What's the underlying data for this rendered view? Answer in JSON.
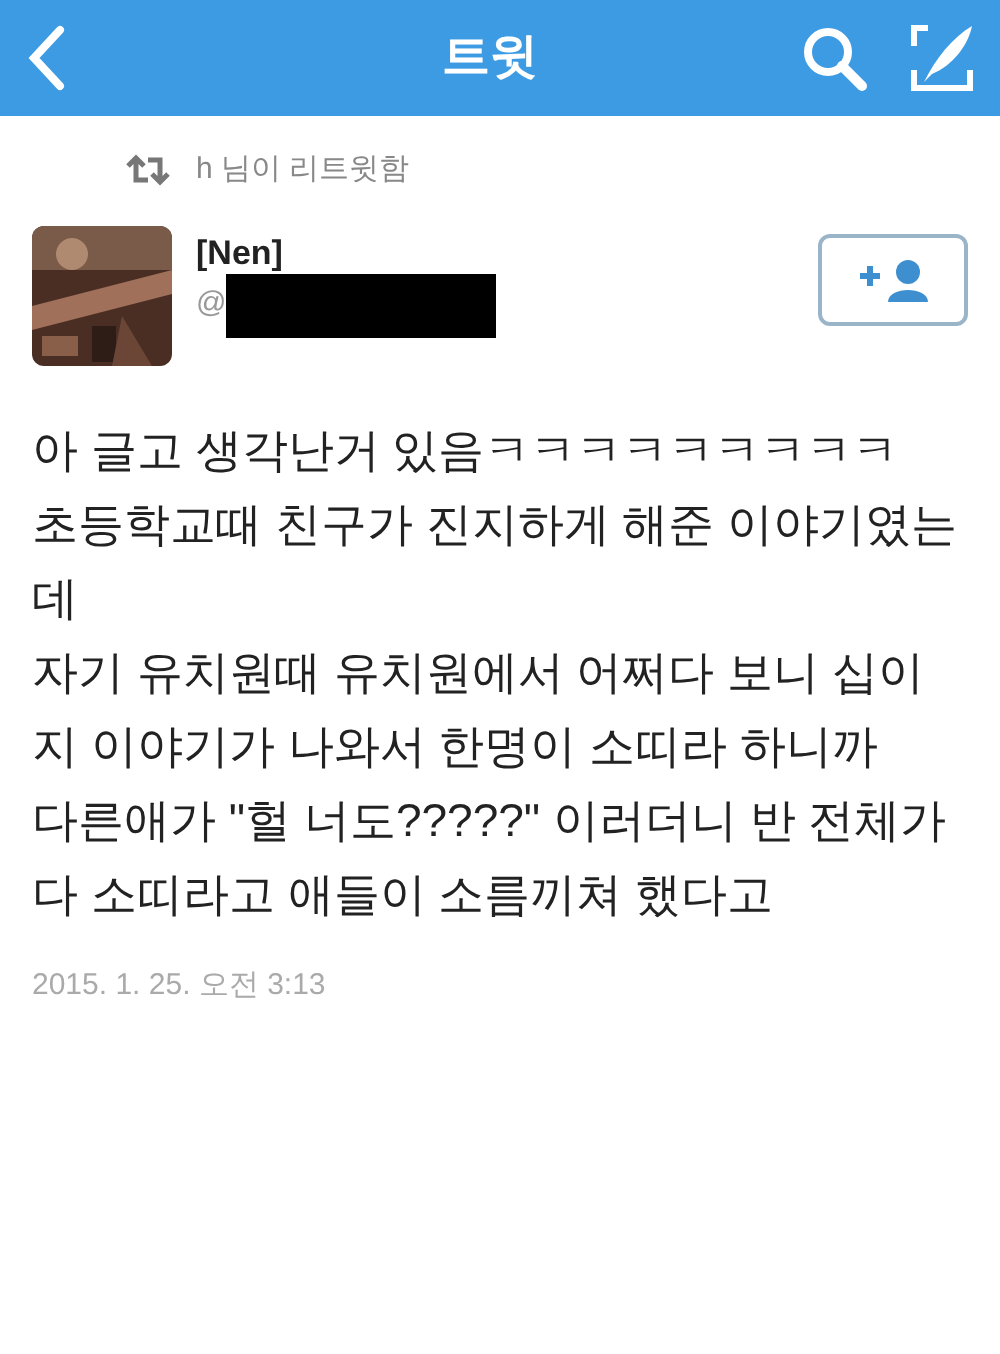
{
  "header": {
    "title": "트윗"
  },
  "retweet": {
    "text": "h 님이 리트윗함"
  },
  "author": {
    "name": "[Nen]",
    "handle": "@"
  },
  "tweet": {
    "lines": [
      "아 글고 생각난거 있음ㅋㅋㅋㅋㅋㅋㅋㅋㅋ",
      "초등학교때 친구가 진지하게 해준 이야기였는데",
      "자기 유치원때 유치원에서 어쩌다 보니 십이지 이야기가 나와서 한명이 소띠라 하니까",
      "다른애가 \"헐 너도?????\" 이러더니 반 전체가 다 소띠라고 애들이 소름끼쳐 했다고"
    ]
  },
  "timestamp": "2015. 1. 25. 오전 3:13"
}
